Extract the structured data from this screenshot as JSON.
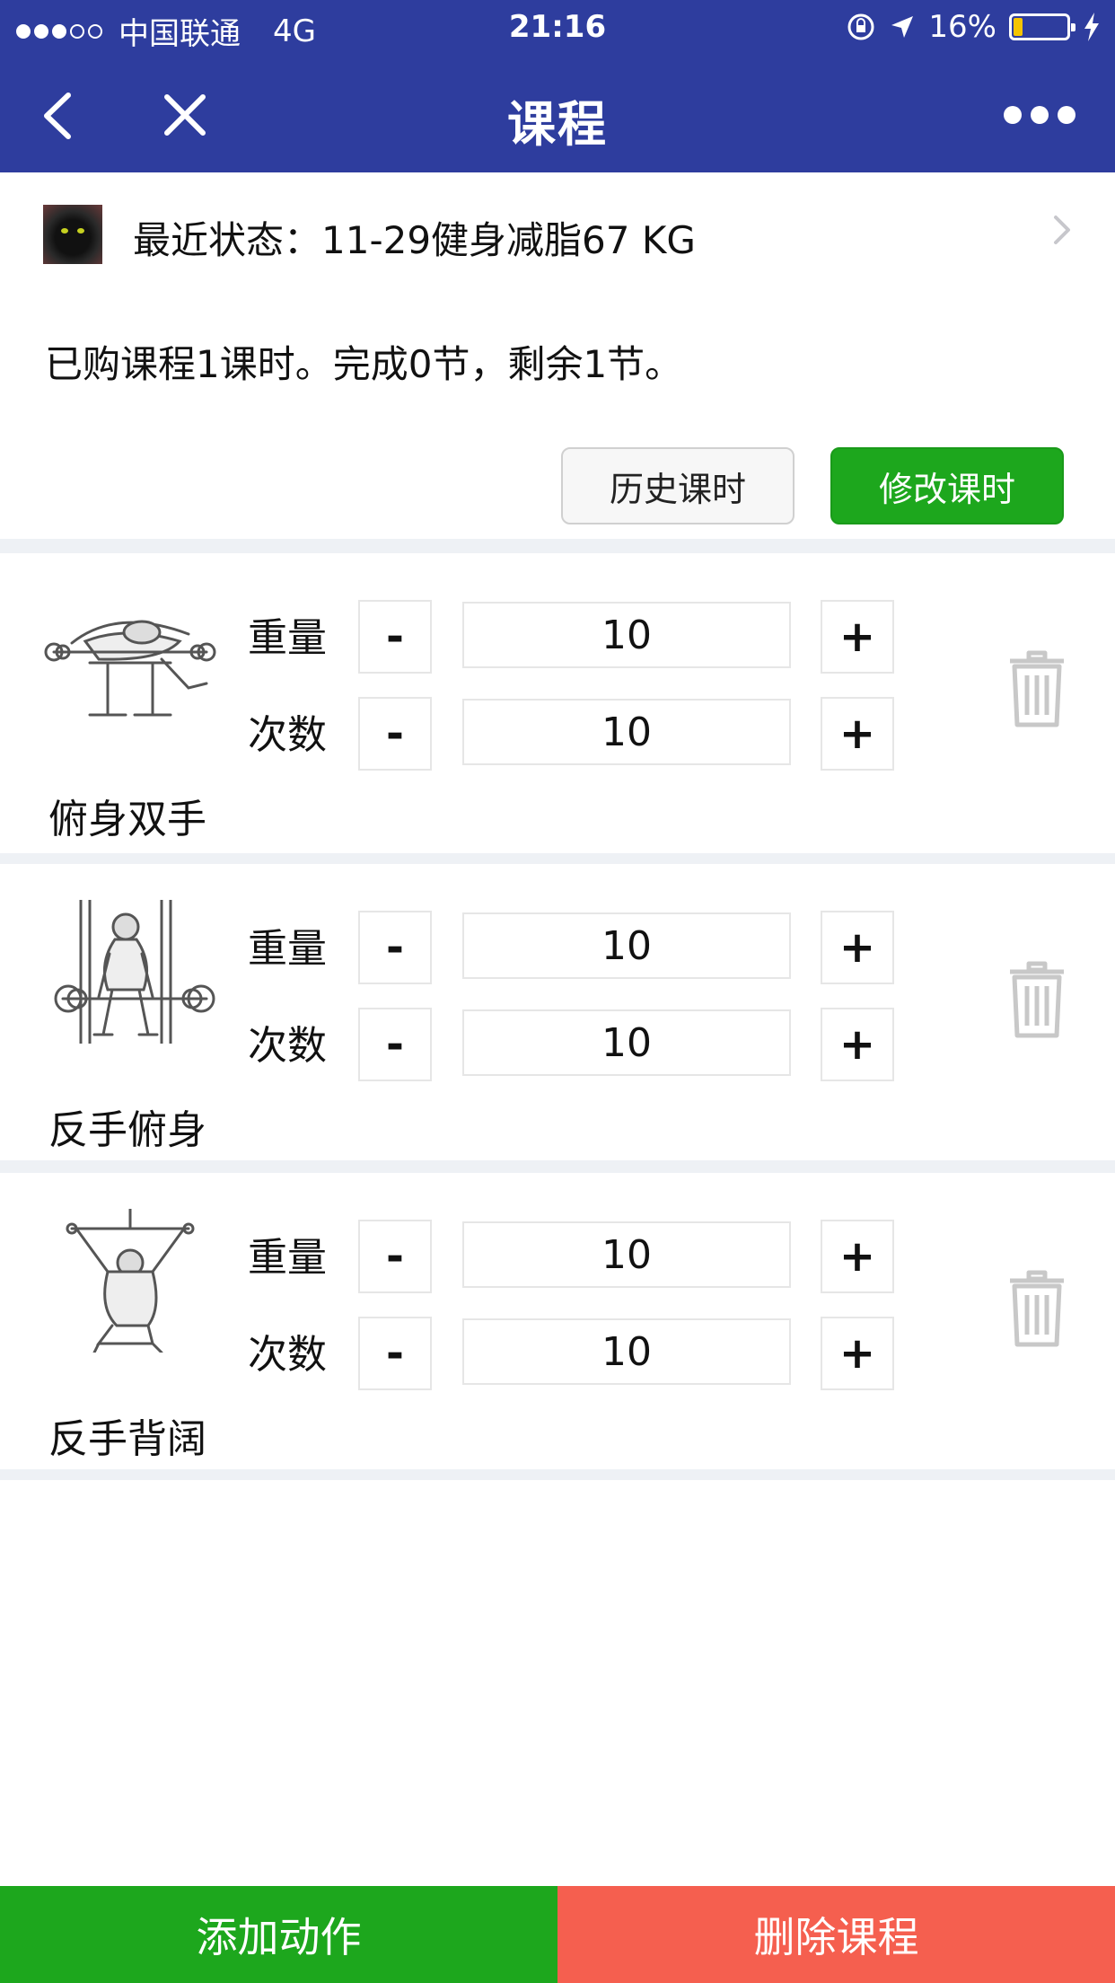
{
  "statusbar": {
    "carrier": "中国联通",
    "network": "4G",
    "time": "21:16",
    "battery": "16%",
    "battery_level": 0.16
  },
  "navbar": {
    "title": "课程",
    "back_icon": "chevron-left-icon",
    "close_icon": "close-icon",
    "more_icon": "more-horizontal-icon"
  },
  "profile": {
    "status_text": "最近状态：11-29健身减脂67 KG"
  },
  "summary": "已购课程1课时。完成0节，剩余1节。",
  "buttons": {
    "history": "历史课时",
    "modify": "修改课时"
  },
  "labels": {
    "weight": "重量",
    "reps": "次数",
    "minus": "-",
    "plus": "+"
  },
  "exercises": [
    {
      "name": "俯身双手",
      "weight": "10",
      "reps": "10"
    },
    {
      "name": "反手俯身",
      "weight": "10",
      "reps": "10"
    },
    {
      "name": "反手背阔",
      "weight": "10",
      "reps": "10"
    }
  ],
  "bottom": {
    "add": "添加动作",
    "delete": "删除课程"
  },
  "colors": {
    "nav": "#2e3d9e",
    "green": "#1da71d",
    "red": "#f55f4f",
    "separator": "#eef1f5"
  }
}
